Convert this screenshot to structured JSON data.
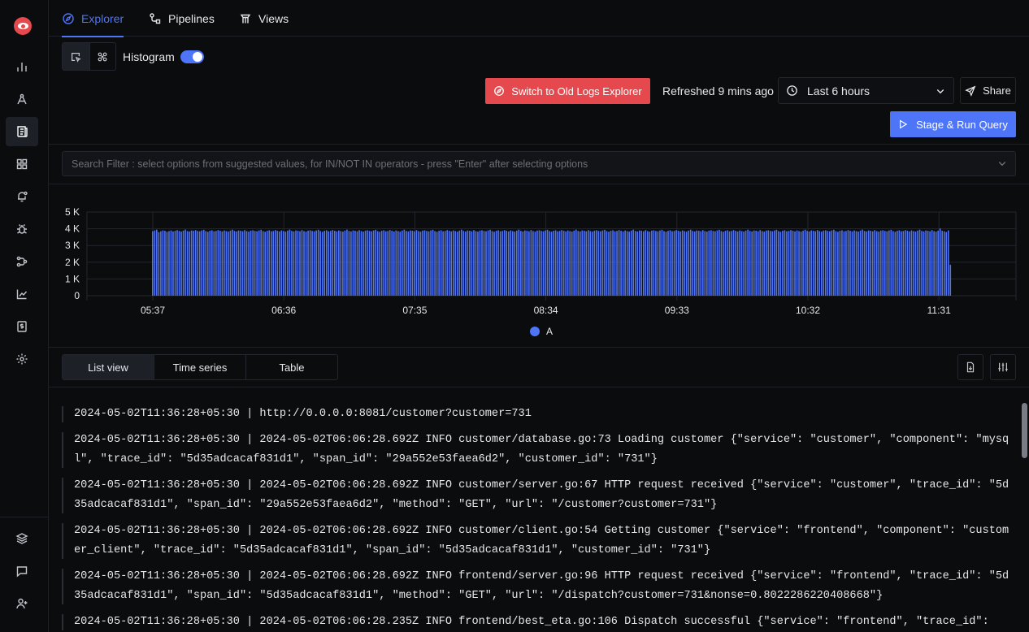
{
  "nav": {
    "tabs": [
      {
        "label": "Explorer",
        "icon": "compass-icon"
      },
      {
        "label": "Pipelines",
        "icon": "pipeline-icon"
      },
      {
        "label": "Views",
        "icon": "views-icon"
      }
    ]
  },
  "sidebar": {
    "items": [
      "services-icon",
      "traces-icon",
      "logs-icon",
      "dashboards-icon",
      "alerts-icon",
      "exceptions-icon",
      "service-map-icon",
      "usage-icon",
      "billing-icon",
      "settings-icon",
      "layers-icon",
      "chat-icon",
      "invite-user-icon"
    ]
  },
  "toolbar": {
    "histogram_label": "Histogram",
    "histogram_enabled": true,
    "switch_old_label": "Switch to Old Logs Explorer",
    "refreshed_text": "Refreshed 9 mins ago",
    "time_range": "Last 6 hours",
    "share_label": "Share",
    "run_label": "Stage & Run Query"
  },
  "search": {
    "placeholder": "Search Filter : select options from suggested values, for IN/NOT IN operators - press \"Enter\" after selecting options"
  },
  "colors": {
    "accent": "#4e74f8",
    "danger": "#e5484d",
    "background": "#0b0c0e"
  },
  "chart_data": {
    "type": "bar",
    "x_ticks": [
      "05:37",
      "06:36",
      "07:35",
      "08:34",
      "09:33",
      "10:32",
      "11:31"
    ],
    "y_ticks": [
      "0",
      "1 K",
      "2 K",
      "3 K",
      "4 K",
      "5 K"
    ],
    "ylim": [
      0,
      5000
    ],
    "legend": [
      "A"
    ],
    "series": [
      {
        "name": "A",
        "values": [
          3850,
          3900,
          3950,
          3800,
          3850,
          3900,
          3880,
          3820,
          3860,
          3900,
          3840,
          3880,
          3920,
          3870,
          3830,
          3890,
          3950,
          3860,
          3840,
          3900,
          3880,
          3920,
          3870,
          3850,
          3900,
          3940,
          3860,
          3820,
          3880,
          3910,
          3850,
          3870,
          3920,
          3880,
          3840,
          3900,
          3860,
          3830,
          3890,
          3950,
          3870,
          3840,
          3900,
          3880,
          3850,
          3920,
          3860,
          3830,
          3890,
          3910,
          3870,
          3850,
          3900,
          3940,
          3860,
          3820,
          3880,
          3910,
          3850,
          3870,
          3920,
          3880,
          3840,
          3900,
          3860,
          3830,
          3890,
          3950,
          3870,
          3840,
          3900,
          3880,
          3850,
          3920,
          3860,
          3830,
          3890,
          3910,
          3870,
          3850,
          3900,
          3940,
          3860,
          3820,
          3880,
          3910,
          3850,
          3870,
          3920,
          3880,
          3840,
          3900,
          3860,
          3830,
          3890,
          3950,
          3870,
          3840,
          3900,
          3880,
          3850,
          3920,
          3860,
          3830,
          3890,
          3910,
          3870,
          3850,
          3900,
          3940,
          3860,
          3820,
          3880,
          3910,
          3850,
          3870,
          3920,
          3880,
          3840,
          3900,
          3860,
          3830,
          3890,
          3950,
          3870,
          3840,
          3900,
          3880,
          3850,
          3920,
          3860,
          3830,
          3890,
          3910,
          3870,
          3850,
          3900,
          3940,
          3860,
          3820,
          3880,
          3910,
          3850,
          3870,
          3920,
          3880,
          3840,
          3900,
          3860,
          3830,
          3890,
          3950,
          3870,
          3840,
          3900,
          3880,
          3850,
          3920,
          3860,
          3830,
          3890,
          3910,
          3870,
          3850,
          3900,
          3940,
          3860,
          3820,
          3880,
          3910,
          3850,
          3870,
          3920,
          3880,
          3840,
          3900,
          3860,
          3830,
          3890,
          3950,
          3870,
          3840,
          3900,
          3880,
          3850,
          3920,
          3860,
          3830,
          3890,
          3910,
          3870,
          3850,
          3900,
          3940,
          3860,
          3820,
          3880,
          3910,
          3850,
          3870,
          3920,
          3880,
          3840,
          3900,
          3860,
          3830,
          3890,
          3950,
          3870,
          3840,
          3900,
          3880,
          3850,
          3920,
          3860,
          3830,
          3890,
          3910,
          3870,
          3850,
          3900,
          3940,
          3860,
          3820,
          3880,
          3910,
          3850,
          3870,
          3920,
          3880,
          3840,
          3900,
          3860,
          3830,
          3890,
          3950,
          3870,
          3840,
          3900,
          3880,
          3850,
          3920,
          3860,
          3830,
          3890,
          3910,
          3870,
          3850,
          3900,
          3940,
          3860,
          3820,
          3880,
          3910,
          3850,
          3870,
          3920,
          3880,
          3840,
          3900,
          3860,
          3830,
          3890,
          3950,
          3870,
          3840,
          3900,
          3880,
          3850,
          3920,
          3860,
          3830,
          3890,
          3910,
          3870,
          3850,
          3900,
          3940,
          3860,
          3820,
          3880,
          3910,
          3850,
          3870,
          3920,
          3880,
          3840,
          3900,
          3860,
          3830,
          3890,
          3950,
          3870,
          3840,
          3900,
          3880,
          3850,
          3920,
          3860,
          3830,
          3890,
          3910,
          3870,
          3850,
          3900,
          3940,
          3860,
          3820,
          3880,
          3910,
          3850,
          3870,
          3920,
          3880,
          3840,
          3900,
          3860,
          3830,
          3890,
          3950,
          3870,
          3840,
          3900,
          3880,
          3850,
          3920,
          3860,
          3830,
          3890,
          3910,
          3870,
          3850,
          3900,
          3940,
          3860,
          3820,
          3880,
          3910,
          3850,
          3870,
          3920,
          3880,
          3840,
          3900,
          3860,
          3830,
          3890,
          3950,
          3870,
          3840,
          3900,
          3880,
          3850,
          3920,
          3860,
          3830,
          3890,
          3910,
          3870,
          3850,
          3900,
          3940,
          3860,
          3820,
          3880,
          3910,
          3850,
          3870,
          3920,
          3880,
          3840,
          3900,
          3860,
          3830,
          3890,
          3950,
          3870,
          3840,
          3900,
          3880,
          3850,
          3920,
          3860,
          3830,
          3890,
          4020,
          3880,
          3850,
          3800,
          3900,
          1850
        ]
      }
    ]
  },
  "view_tabs": [
    {
      "label": "List view"
    },
    {
      "label": "Time series"
    },
    {
      "label": "Table"
    }
  ],
  "logs": [
    "2024-05-02T11:36:28+05:30 | http://0.0.0.0:8081/customer?customer=731",
    "2024-05-02T11:36:28+05:30 | 2024-05-02T06:06:28.692Z INFO customer/database.go:73 Loading customer {\"service\": \"customer\", \"component\": \"mysql\", \"trace_id\": \"5d35adcacaf831d1\", \"span_id\": \"29a552e53faea6d2\", \"customer_id\": \"731\"}",
    "2024-05-02T11:36:28+05:30 | 2024-05-02T06:06:28.692Z INFO customer/server.go:67 HTTP request received {\"service\": \"customer\", \"trace_id\": \"5d35adcacaf831d1\", \"span_id\": \"29a552e53faea6d2\", \"method\": \"GET\", \"url\": \"/customer?customer=731\"}",
    "2024-05-02T11:36:28+05:30 | 2024-05-02T06:06:28.692Z INFO customer/client.go:54 Getting customer {\"service\": \"frontend\", \"component\": \"customer_client\", \"trace_id\": \"5d35adcacaf831d1\", \"span_id\": \"5d35adcacaf831d1\", \"customer_id\": \"731\"}",
    "2024-05-02T11:36:28+05:30 | 2024-05-02T06:06:28.692Z INFO frontend/server.go:96 HTTP request received {\"service\": \"frontend\", \"trace_id\": \"5d35adcacaf831d1\", \"span_id\": \"5d35adcacaf831d1\", \"method\": \"GET\", \"url\": \"/dispatch?customer=731&nonse=0.8022286220408668\"}",
    "2024-05-02T11:36:28+05:30 | 2024-05-02T06:06:28.235Z INFO frontend/best_eta.go:106 Dispatch successful {\"service\": \"frontend\", \"trace_id\":"
  ]
}
